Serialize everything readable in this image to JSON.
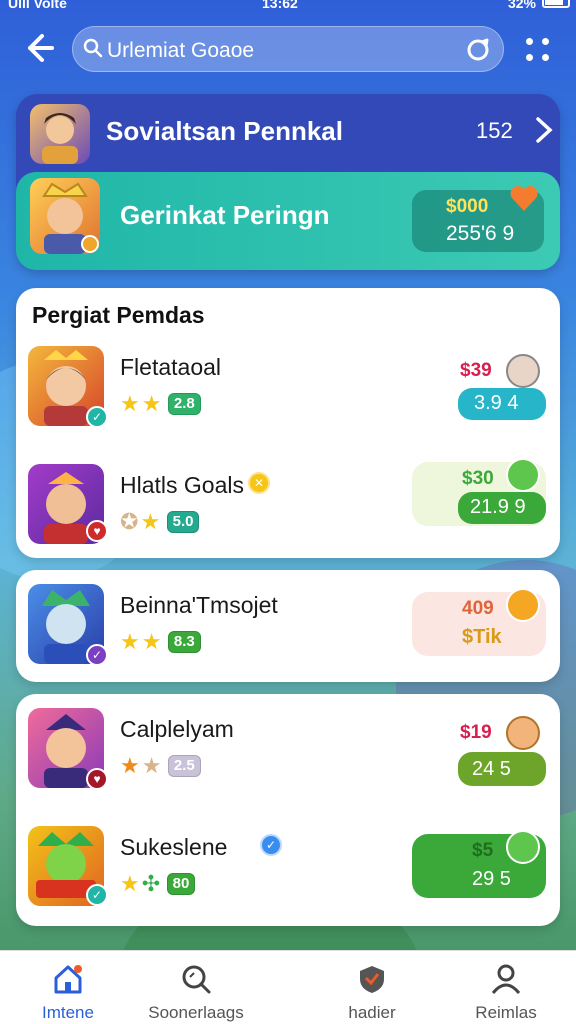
{
  "status_bar": {
    "left": "Ulll Volte",
    "time": "13:62",
    "right": "32%"
  },
  "search": {
    "value": "Urlemiat Goaoe"
  },
  "featured": {
    "title": "Sovialtsan Pennkal",
    "count": "152",
    "subtitle": "Gerinkat Peringn",
    "prize_amount": "$000",
    "prize_count": "255'6  9"
  },
  "section": {
    "title": "Pergiat Pemdas"
  },
  "games": [
    {
      "name": "Fletataoal",
      "rating": "2.8",
      "price": "$39",
      "price_sub": "3.9  4",
      "stars": [
        1,
        1
      ]
    },
    {
      "name": "Hlatls Goals",
      "rating": "5.0",
      "price": "$30",
      "price_sub": "21.9  9",
      "stars": [
        0.5,
        1
      ]
    },
    {
      "name": "Beinna'Tmsojet",
      "rating": "8.3",
      "price": "409",
      "price_sub": "$Tik",
      "stars": [
        1,
        1
      ]
    },
    {
      "name": "Calplelyam",
      "rating": "2.5",
      "price": "$19",
      "price_sub": "24  5",
      "stars": [
        1,
        0.5
      ]
    },
    {
      "name": "Sukeslene",
      "rating": "80",
      "price": "$5",
      "price_sub": "29  5",
      "stars": [
        1,
        0.5
      ]
    }
  ],
  "nav": [
    {
      "label": "Imtene",
      "icon": "home-icon"
    },
    {
      "label": "Soonerlaags",
      "icon": "search-icon"
    },
    {
      "label": "hadier",
      "icon": "shield-icon"
    },
    {
      "label": "Reimlas",
      "icon": "profile-icon"
    }
  ],
  "colors": {
    "accent_blue": "#2b5fd9",
    "teal": "#1fb6a8",
    "green": "#3ba83a",
    "price_red": "#d8204f"
  }
}
